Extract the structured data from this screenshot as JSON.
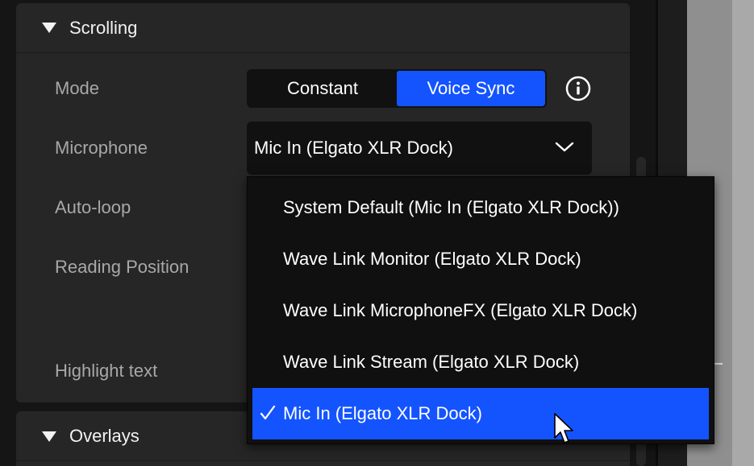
{
  "sections": {
    "scrolling": {
      "title": "Scrolling"
    },
    "overlays": {
      "title": "Overlays"
    }
  },
  "rows": {
    "mode": "Mode",
    "microphone": "Microphone",
    "auto_loop": "Auto-loop",
    "reading_position": "Reading Position",
    "highlight_text": "Highlight text"
  },
  "mode_options": {
    "constant": "Constant",
    "voice_sync": "Voice Sync",
    "selected": "Voice Sync"
  },
  "microphone": {
    "selected": "Mic In (Elgato XLR Dock)",
    "options": [
      "System Default (Mic In (Elgato XLR Dock))",
      "Wave Link Monitor (Elgato XLR Dock)",
      "Wave Link MicrophoneFX (Elgato XLR Dock)",
      "Wave Link Stream (Elgato XLR Dock)",
      "Mic In (Elgato XLR Dock)"
    ],
    "checkmark": "✓"
  },
  "icons": {
    "info": "info-icon",
    "chevron": "chevron-down-icon",
    "section_toggle": "triangle-down-icon",
    "check": "check-icon",
    "pointer": "mouse-pointer-icon"
  },
  "colors": {
    "accent": "#1454ff",
    "panel": "#262626",
    "control": "#111111",
    "label": "#a8a8a8"
  }
}
